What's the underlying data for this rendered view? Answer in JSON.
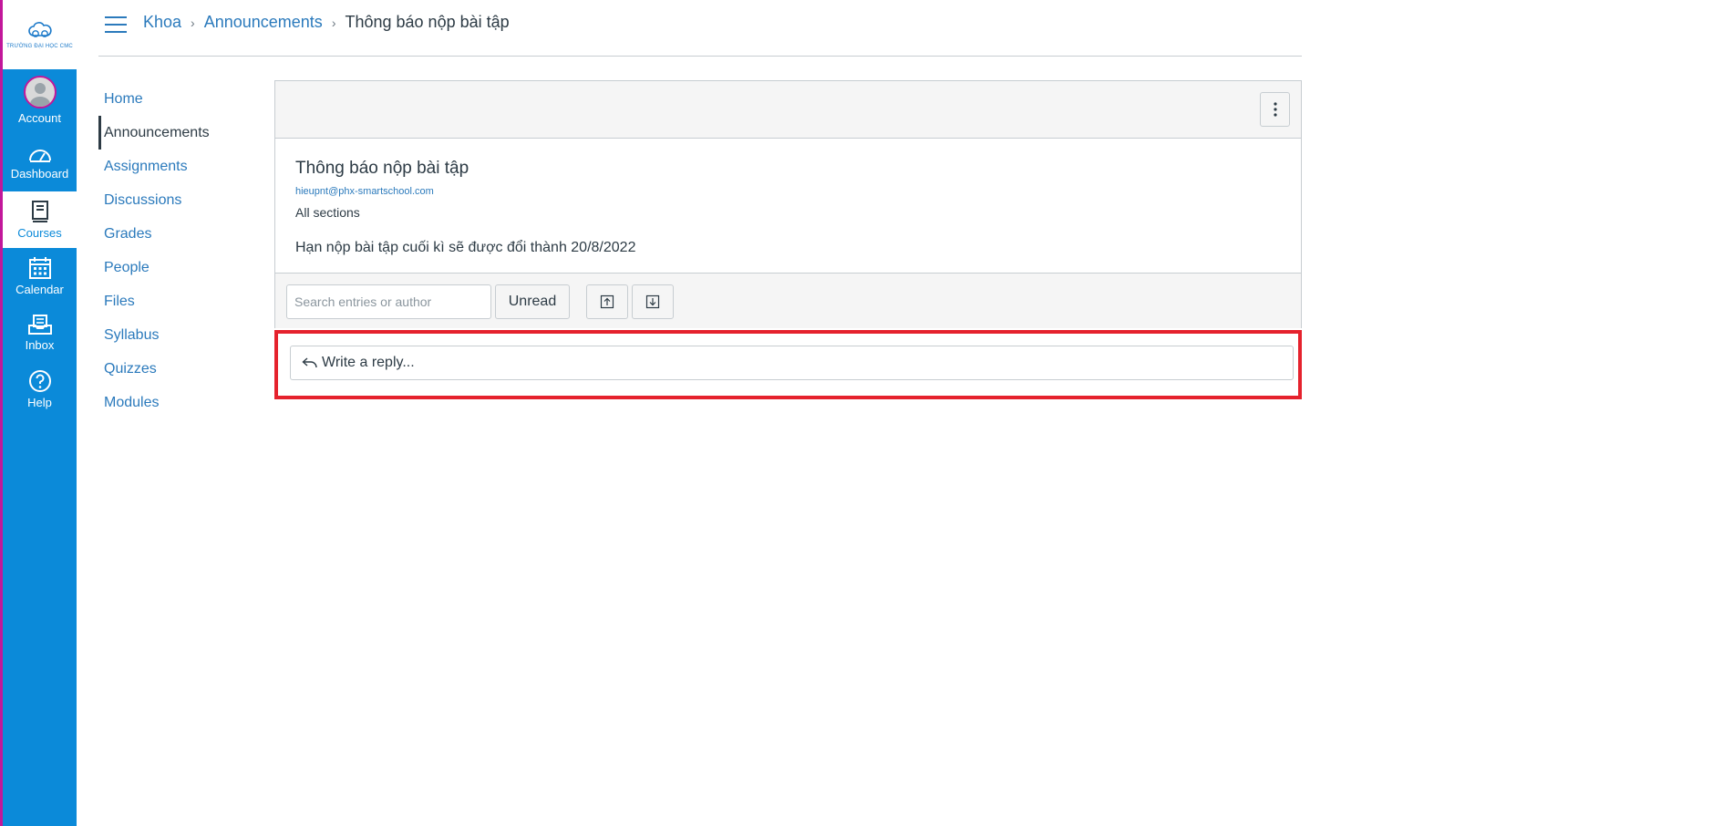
{
  "logo": {
    "text": "TRƯỜNG ĐẠI HỌC CMC"
  },
  "global_nav": {
    "items": [
      {
        "label": "Account",
        "icon": "avatar-icon"
      },
      {
        "label": "Dashboard",
        "icon": "dashboard-icon"
      },
      {
        "label": "Courses",
        "icon": "book-icon"
      },
      {
        "label": "Calendar",
        "icon": "calendar-icon"
      },
      {
        "label": "Inbox",
        "icon": "inbox-icon"
      },
      {
        "label": "Help",
        "icon": "help-icon"
      }
    ],
    "active": "Courses"
  },
  "breadcrumb": {
    "items": [
      "Khoa",
      "Announcements"
    ],
    "current": "Thông báo nộp bài tập"
  },
  "course_nav": {
    "items": [
      "Home",
      "Announcements",
      "Assignments",
      "Discussions",
      "Grades",
      "People",
      "Files",
      "Syllabus",
      "Quizzes",
      "Modules"
    ],
    "active": "Announcements"
  },
  "announcement": {
    "title": "Thông báo nộp bài tập",
    "author": "hieupnt@phx-smartschool.com",
    "sections": "All sections",
    "message": "Hạn nộp bài tập cuối kì sẽ được đổi thành 20/8/2022"
  },
  "toolbar": {
    "search_placeholder": "Search entries or author",
    "unread_label": "Unread"
  },
  "reply": {
    "placeholder": "Write a reply..."
  },
  "colors": {
    "nav_bg": "#0b8ad9",
    "link": "#2b7abc",
    "text": "#2d3b45",
    "highlight": "#e5222d",
    "accent_edge": "#c2179a"
  }
}
